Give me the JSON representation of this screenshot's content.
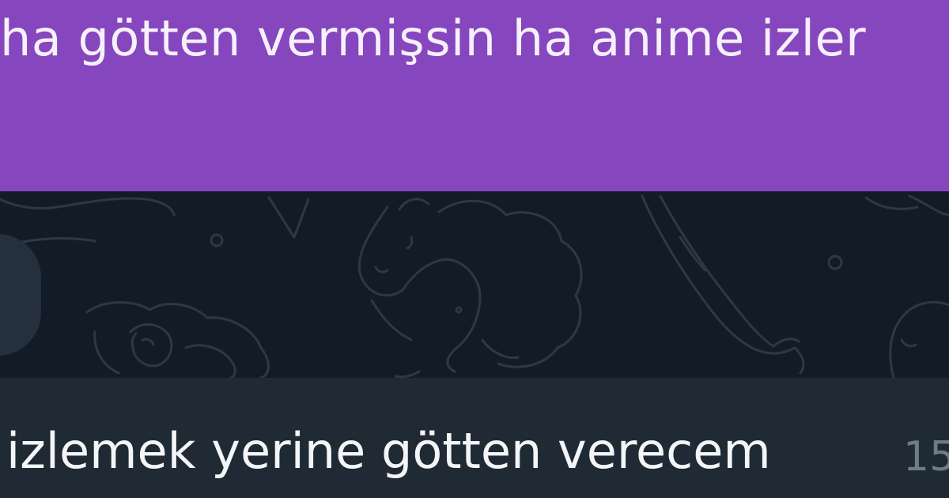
{
  "chat": {
    "outgoing_message": {
      "text": "ha götten vermişsin ha anime izler"
    },
    "incoming_message": {
      "text": "izlemek yerine götten verecem",
      "time_fragment": "15"
    }
  },
  "colors": {
    "outgoing_bubble": "#8546be",
    "incoming_bubble": "#1f2a35",
    "wallpaper": "#131c26",
    "doodle_lines": "#2b3947"
  },
  "icons": {
    "wallpaper_doodles": [
      "sheep-doodle",
      "bird-doodle",
      "leaf-doodle",
      "creature-doodle",
      "circle-doodle"
    ]
  }
}
